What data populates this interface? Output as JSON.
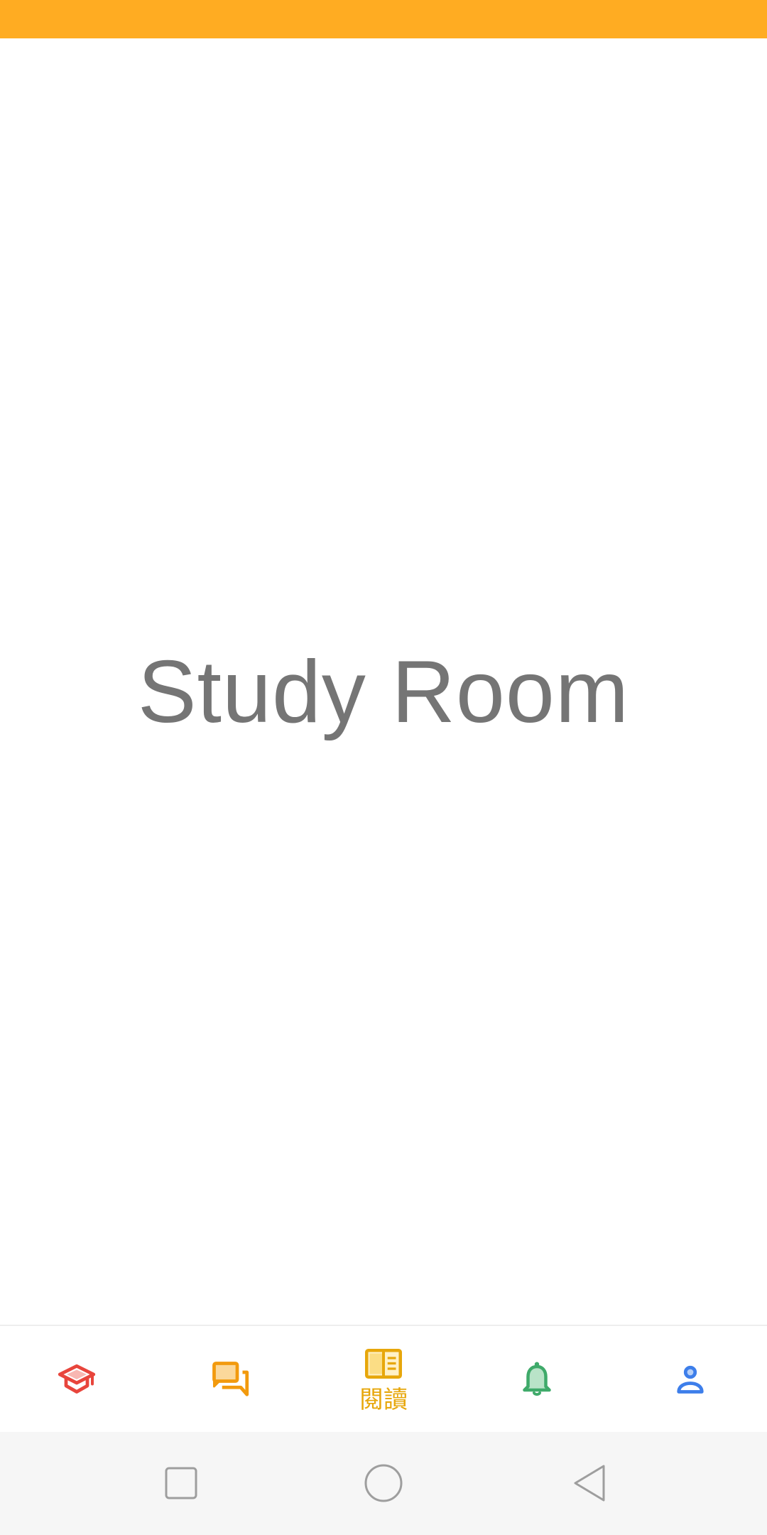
{
  "screen": {
    "title": "Study Room"
  },
  "colors": {
    "status_bar": "#FFAC22",
    "title_text": "#757575",
    "learn": "#E8453C",
    "discuss": "#F29A0E",
    "read": "#E7A70B",
    "notify": "#3FAA6A",
    "profile": "#3D7EEA",
    "system_nav_bg": "#F6F6F6",
    "system_nav_icon": "#9E9E9E"
  },
  "bottom_nav": {
    "items": [
      {
        "id": "learn",
        "icon": "graduation-cap-icon",
        "label": ""
      },
      {
        "id": "discuss",
        "icon": "chat-bubbles-icon",
        "label": ""
      },
      {
        "id": "read",
        "icon": "open-book-icon",
        "label": "閱讀",
        "active": true
      },
      {
        "id": "notify",
        "icon": "bell-icon",
        "label": ""
      },
      {
        "id": "profile",
        "icon": "person-icon",
        "label": ""
      }
    ]
  },
  "system_nav": {
    "buttons": [
      "recent-apps-icon",
      "home-icon",
      "back-icon"
    ]
  }
}
